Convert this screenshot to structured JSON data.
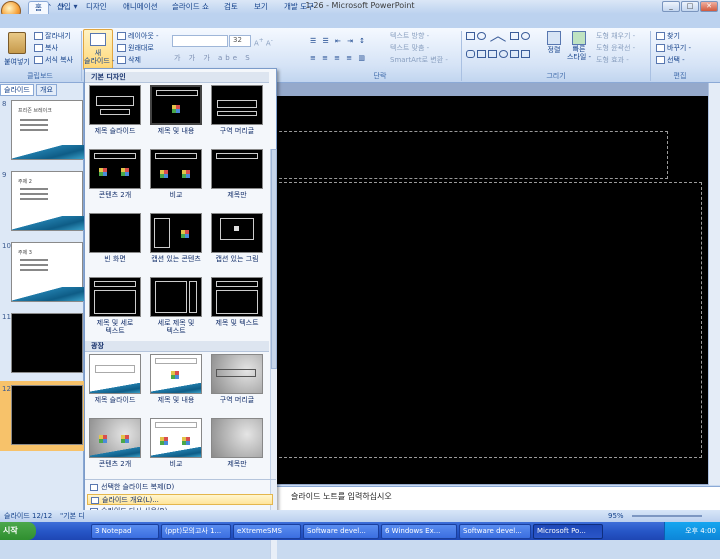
{
  "window": {
    "title": "1-26 - Microsoft PowerPoint"
  },
  "tabs": [
    "홈",
    "삽입",
    "디자인",
    "애니메이션",
    "슬라이드 쇼",
    "검토",
    "보기",
    "개발 도구"
  ],
  "ribbon": {
    "paste": "붙여넣기",
    "cut": "잘라내기",
    "copy": "복사",
    "format_painter": "서식 복사",
    "new_slide": "새\n슬라이드 -",
    "layout": "레이아웃 -",
    "reset": "원래대로",
    "delete": "삭제",
    "font_size": "32",
    "text_direction": "텍스트 방향 -",
    "text_align": "텍스트 맞춤 -",
    "smartart": "SmartArt로 변환 -",
    "arrange": "정렬",
    "quick_styles": "빠른\n스타일 -",
    "shape_fill": "도형 채우기 -",
    "shape_outline": "도형 윤곽선 -",
    "shape_effects": "도형 효과 -",
    "find": "찾기",
    "replace": "바꾸기 -",
    "select": "선택 -",
    "groups": {
      "clipboard": "클립보드",
      "paragraph": "단락",
      "drawing": "그리기",
      "editing": "편집"
    }
  },
  "slide_panel": {
    "tabs": [
      "슬라이드",
      "개요"
    ],
    "thumbs": [
      {
        "num": "8",
        "title": "프리즌 브레이크",
        "dark": false
      },
      {
        "num": "9",
        "title": "주제 2",
        "dark": false
      },
      {
        "num": "10",
        "title": "주제 3",
        "dark": false
      },
      {
        "num": "11",
        "title": "",
        "dark": true
      },
      {
        "num": "12",
        "title": "",
        "dark": true
      }
    ]
  },
  "gallery": {
    "section_basic": "기본 디자인",
    "section_flow": "광장",
    "basic_layouts": [
      "제목 슬라이드",
      "제목 및 내용",
      "구역 머리글",
      "콘텐츠 2개",
      "비교",
      "제목만",
      "빈 화면",
      "캡션 있는 콘텐츠",
      "캡션 있는 그림",
      "제목 및 세로\n텍스트",
      "세로 제목 및\n텍스트",
      "제목 및 텍스트"
    ],
    "flow_layouts": [
      "제목 슬라이드",
      "제목 및 내용",
      "구역 머리글",
      "콘텐츠 2개",
      "비교",
      "제목만"
    ],
    "footer": [
      "선택한 슬라이드 복제(D)",
      "슬라이드 개요(L)...",
      "슬라이드 다시 사용(R)..."
    ]
  },
  "notes": {
    "text": "슬라이드 노트를 입력하십시오"
  },
  "status": {
    "slide": "슬라이드 12/12",
    "theme": "\"기본 디",
    "zoom": "95%"
  },
  "taskbar": {
    "start": "시작",
    "items": [
      "3 Notepad",
      "(ppt)모의고사 1...",
      "eXtremeSMS",
      "Software devel...",
      "6 Windows Ex...",
      "Software devel...",
      "Microsoft Po..."
    ],
    "clock": "오후 4:00"
  }
}
